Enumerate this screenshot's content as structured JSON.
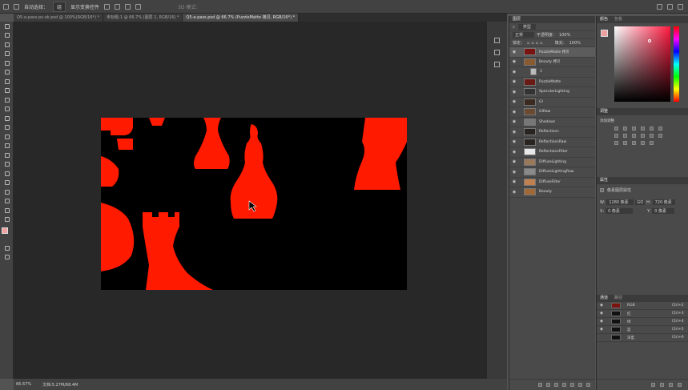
{
  "options_bar": {
    "auto_select_label": "自动选择：",
    "auto_select_value": "组",
    "show_transform_label": "显示变换控件",
    "mode_3d": "3D 模式："
  },
  "tabs": [
    {
      "label": "Q5-a-pass-ps-ok.psd @ 100%(RGB/16*) *"
    },
    {
      "label": "未标题-1 @ 66.7% (图层 1, RGB/16) *"
    },
    {
      "label": "Q5-a-pass.psd @ 66.7% (PuzzleMatte 拷贝, RGB/16*) *"
    }
  ],
  "status": {
    "zoom": "66.67%",
    "doc": "文档:5.27M/68.4M"
  },
  "layers_panel": {
    "title": "图层",
    "filter_kind": "类型",
    "blend_mode": "正常",
    "opacity_label": "不透明度：",
    "opacity_value": "100%",
    "lock_label": "锁定：",
    "fill_label": "填充：",
    "fill_value": "100%",
    "layers": [
      {
        "name": "PuzzleMatte 拷贝",
        "selected": true,
        "thumb": "#7a1410"
      },
      {
        "name": "Beauty 拷贝",
        "selected": false,
        "thumb": "#8a5a30"
      },
      {
        "name": "1",
        "selected": false,
        "thumb": "folder"
      },
      {
        "name": "PuzzleMatte",
        "selected": false,
        "thumb": "#6a1a12"
      },
      {
        "name": "SpecularLighting",
        "selected": false,
        "thumb": "#333"
      },
      {
        "name": "GI",
        "selected": false,
        "thumb": "#3a2a20"
      },
      {
        "name": "GIRaw",
        "selected": false,
        "thumb": "#6a4a30"
      },
      {
        "name": "Shadows",
        "selected": false,
        "thumb": "#777"
      },
      {
        "name": "Reflections",
        "selected": false,
        "thumb": "#2a2420"
      },
      {
        "name": "ReflectionsRaw",
        "selected": false,
        "thumb": "#2a2420"
      },
      {
        "name": "ReflectionsFilter",
        "selected": false,
        "thumb": "#e8e8e8"
      },
      {
        "name": "DiffuseLighting",
        "selected": false,
        "thumb": "#9a7a5a"
      },
      {
        "name": "DiffuseLightingRaw",
        "selected": false,
        "thumb": "#8a8a8a"
      },
      {
        "name": "DiffuseFilter",
        "selected": false,
        "thumb": "#c08050"
      },
      {
        "name": "Beauty",
        "selected": false,
        "thumb": "#a06a38"
      }
    ]
  },
  "color_panel": {
    "tab1": "颜色",
    "tab2": "色板"
  },
  "adjustments_panel": {
    "title": "调整",
    "subtitle": "添加调整"
  },
  "properties_panel": {
    "title": "属性",
    "subtitle": "像素图层属性",
    "w_label": "W:",
    "w_value": "1280 像素",
    "h_label": "H:",
    "h_value": "720 像素",
    "link_label": "GO",
    "x_label": "X:",
    "x_value": "0 像素",
    "y_label": "Y:",
    "y_value": "0 像素"
  },
  "channels_panel": {
    "tab1": "通道",
    "tab2": "路径",
    "channels": [
      {
        "name": "RGB",
        "shortcut": "Ctrl+2"
      },
      {
        "name": "红",
        "shortcut": "Ctrl+3"
      },
      {
        "name": "绿",
        "shortcut": "Ctrl+4"
      },
      {
        "name": "蓝",
        "shortcut": "Ctrl+5"
      },
      {
        "name": "深度",
        "shortcut": "Ctrl+6"
      }
    ]
  },
  "colors": {
    "matte_red": "#ff1a00",
    "foreground": "#f0a0a0",
    "canvas_bg": "#000000"
  },
  "icons": [
    "home-icon",
    "move-icon",
    "marquee-icon",
    "lasso-icon",
    "crop-icon",
    "eyedropper-icon",
    "brush-icon",
    "stamp-icon",
    "eraser-icon",
    "gradient-icon",
    "pen-icon",
    "type-icon",
    "hand-icon",
    "zoom-icon",
    "eye-icon",
    "folder-icon",
    "search-icon"
  ]
}
